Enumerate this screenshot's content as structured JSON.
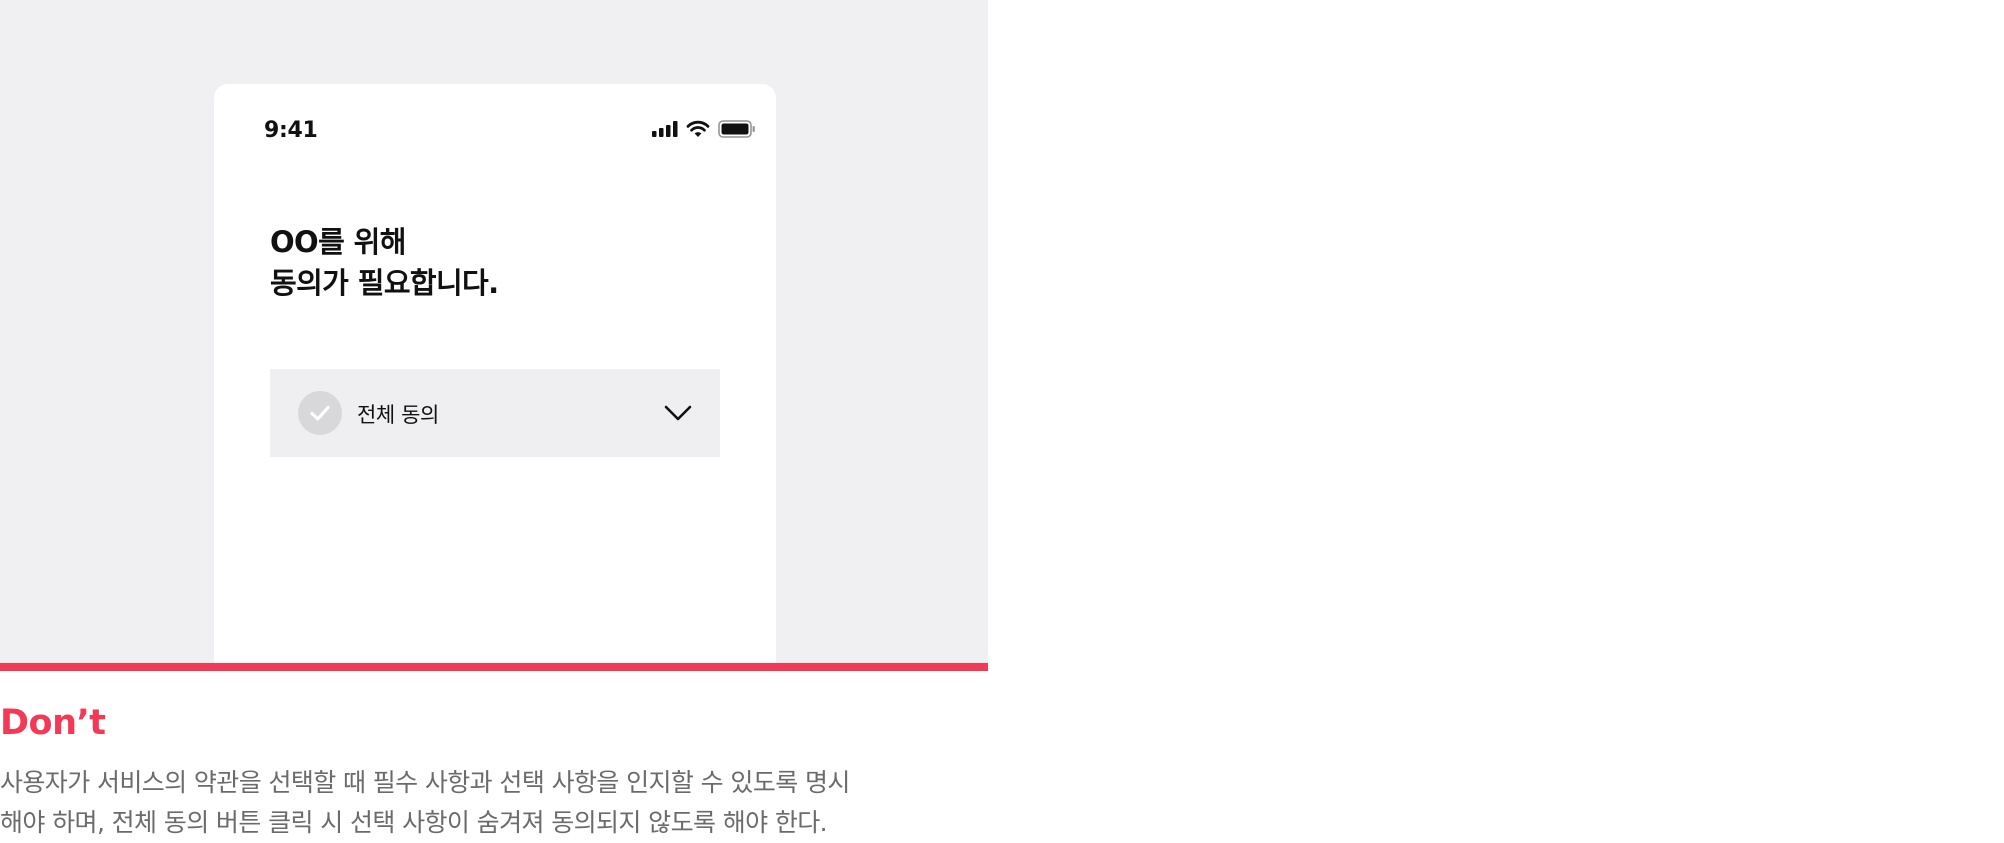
{
  "phone": {
    "status_time": "9:41",
    "status_icons": [
      "cellular-signal-icon",
      "wifi-icon",
      "battery-icon"
    ],
    "title_lines": [
      "OO를 위해",
      "동의가 필요합니다."
    ],
    "agree_all": {
      "label": "전체 동의",
      "checked": false,
      "check_icon": "check-icon",
      "expand_icon": "chevron-down-icon"
    }
  },
  "guideline": {
    "verdict": "Don’t",
    "description_lines": [
      "사용자가 서비스의 약관을 선택할 때 필수 사항과 선택 사항을 인지할 수 있도록 명시",
      "해야 하며, 전체 동의 버튼 클릭 시 선택 사항이 숨겨져 동의되지 않도록 해야 한다."
    ]
  },
  "colors": {
    "panel_background": "#f0f0f2",
    "accent_dont": "#f23a56",
    "row_background": "#efeff1",
    "check_inactive": "#d8d8da",
    "body_text": "#6b6b6b"
  }
}
